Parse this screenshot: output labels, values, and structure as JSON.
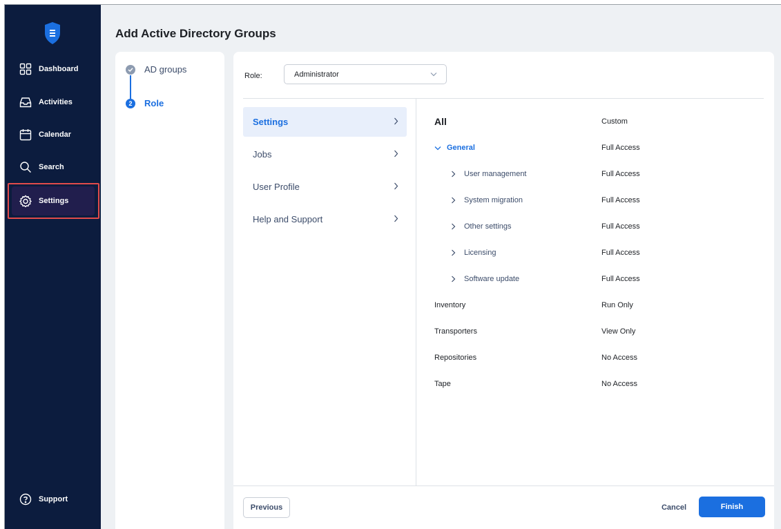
{
  "app": {
    "name": "Nakivo",
    "logo_icon": "shield-logo-icon"
  },
  "colors": {
    "sidebar_bg": "#0c1c3e",
    "accent": "#1b6fe0",
    "highlight_outline": "#e24b4b",
    "content_bg": "#eef1f4"
  },
  "sidebar": {
    "items": [
      {
        "label": "Dashboard",
        "icon": "dashboard-grid-icon"
      },
      {
        "label": "Activities",
        "icon": "inbox-icon"
      },
      {
        "label": "Calendar",
        "icon": "calendar-icon"
      },
      {
        "label": "Search",
        "icon": "search-icon"
      },
      {
        "label": "Settings",
        "icon": "gear-icon",
        "active": true
      }
    ],
    "support": {
      "label": "Support",
      "icon": "help-circle-icon"
    }
  },
  "page": {
    "title": "Add Active Directory Groups"
  },
  "wizard": {
    "steps": [
      {
        "label": "AD groups",
        "state": "done"
      },
      {
        "number": "2",
        "label": "Role",
        "state": "current"
      }
    ]
  },
  "role": {
    "label": "Role:",
    "value": "Administrator"
  },
  "menu": {
    "items": [
      {
        "label": "Settings",
        "active": true
      },
      {
        "label": "Jobs"
      },
      {
        "label": "User Profile"
      },
      {
        "label": "Help and Support"
      }
    ]
  },
  "permissions": {
    "all": {
      "label": "All",
      "value": "Custom"
    },
    "rows": [
      {
        "name": "General",
        "value": "Full Access",
        "level": 0,
        "expanded": true
      },
      {
        "name": "User management",
        "value": "Full Access",
        "level": 1
      },
      {
        "name": "System migration",
        "value": "Full Access",
        "level": 1
      },
      {
        "name": "Other settings",
        "value": "Full Access",
        "level": 1
      },
      {
        "name": "Licensing",
        "value": "Full Access",
        "level": 1
      },
      {
        "name": "Software update",
        "value": "Full Access",
        "level": 1
      },
      {
        "name": "Inventory",
        "value": "Run Only",
        "level": 0
      },
      {
        "name": "Transporters",
        "value": "View Only",
        "level": 0
      },
      {
        "name": "Repositories",
        "value": "No Access",
        "level": 0
      },
      {
        "name": "Tape",
        "value": "No Access",
        "level": 0
      }
    ]
  },
  "footer": {
    "previous": "Previous",
    "cancel": "Cancel",
    "finish": "Finish"
  }
}
